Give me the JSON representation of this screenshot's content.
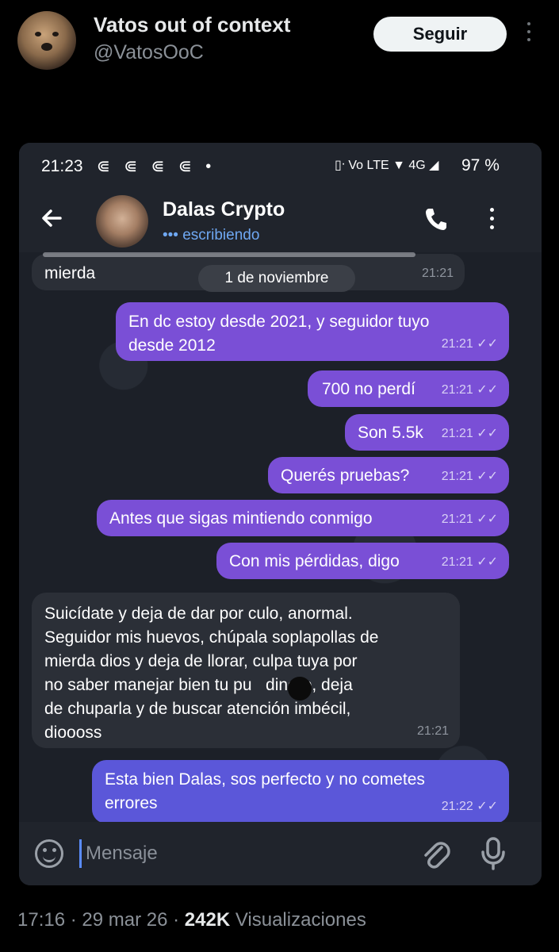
{
  "tweet": {
    "display_name": "Vatos out of context",
    "handle": "@VatosOoC",
    "follow_label": "Seguir",
    "time": "17:16",
    "date": "29 mar 26",
    "views_count": "242K",
    "views_label": "Visualizaciones"
  },
  "phone": {
    "status": {
      "time": "21:23",
      "notifications": "⋐ ⋐ ⋐ ⋐ •",
      "icons": "▯ᐧ Vo LTE ▼ 4G ◢",
      "battery": "97 %"
    },
    "appbar": {
      "contact_name": "Dalas Crypto",
      "contact_status": "••• escribiendo"
    },
    "date_chip": "1 de noviembre",
    "messages": [
      {
        "dir": "in",
        "text": "mierda",
        "time": "21:21"
      },
      {
        "dir": "out",
        "text": "En dc estoy desde 2021, y seguidor tuyo\ndesde 2012",
        "time": "21:21 ✓✓"
      },
      {
        "dir": "out",
        "text": "700 no perdí",
        "time": "21:21 ✓✓"
      },
      {
        "dir": "out",
        "text": "Son 5.5k",
        "time": "21:21 ✓✓"
      },
      {
        "dir": "out",
        "text": "Querés pruebas?",
        "time": "21:21 ✓✓"
      },
      {
        "dir": "out",
        "text": "Antes que sigas mintiendo conmigo",
        "time": "21:21 ✓✓"
      },
      {
        "dir": "out",
        "text": "Con mis pérdidas, digo",
        "time": "21:21 ✓✓"
      },
      {
        "dir": "in",
        "text": "Suicídate y deja de dar por culo, anormal.\nSeguidor mis huevos, chúpala soplapollas de\nmierda dios y deja de llorar, culpa tuya por\nno saber manejar bien tu pu   dinero, deja\nde chuparla y de buscar atención imbécil,\ndioooss",
        "time": "21:21"
      },
      {
        "dir": "out",
        "text": "Esta bien Dalas, sos perfecto y no cometes\nerrores",
        "time": "21:22 ✓✓"
      }
    ],
    "input": {
      "placeholder": "Mensaje"
    }
  },
  "colors": {
    "outgoing_bubble": "#7a4fd6",
    "incoming_bubble": "#2b2f37",
    "accent_status": "#6fa8f3"
  }
}
